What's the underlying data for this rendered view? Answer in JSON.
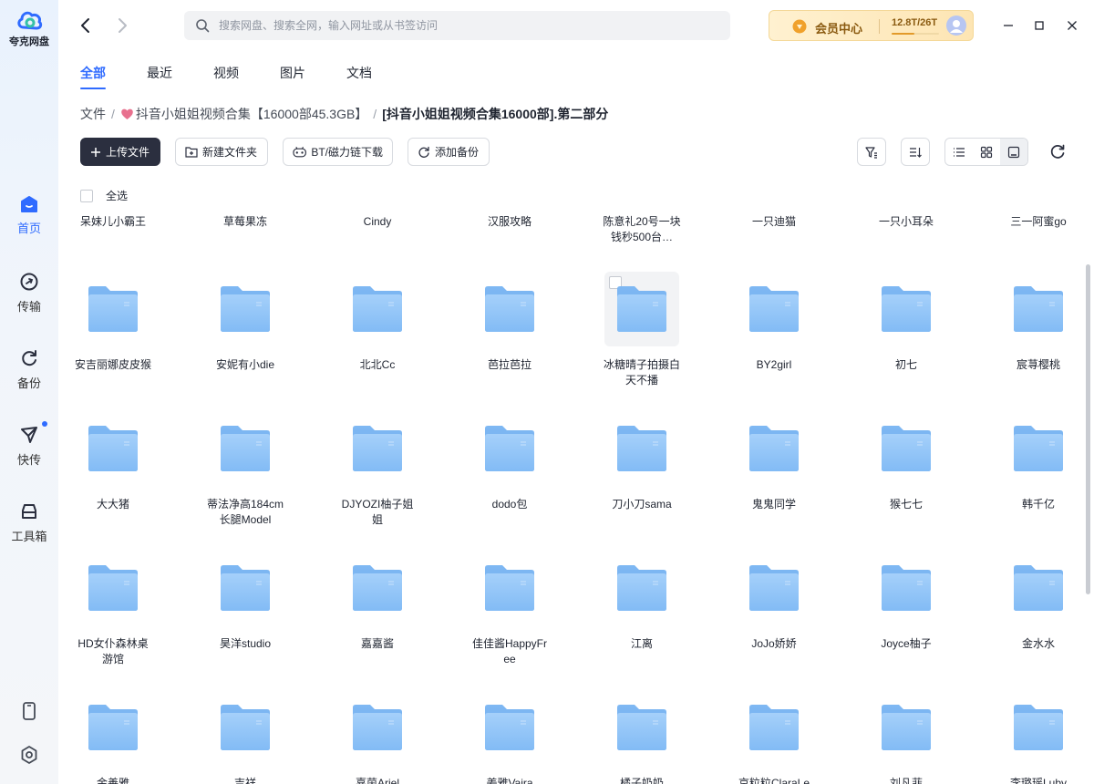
{
  "app": {
    "logo_text": "夸克网盘",
    "accent": "#2f6bff"
  },
  "sidebar": {
    "items": [
      {
        "label": "首页",
        "icon": "home-icon"
      },
      {
        "label": "传输",
        "icon": "transfer-icon"
      },
      {
        "label": "备份",
        "icon": "backup-icon"
      },
      {
        "label": "快传",
        "icon": "quick-send-icon"
      },
      {
        "label": "工具箱",
        "icon": "toolbox-icon"
      }
    ]
  },
  "search": {
    "placeholder": "搜索网盘、搜索全网，输入网址或从书签访问"
  },
  "vip": {
    "label": "会员中心",
    "storage": "12.8T/26T",
    "usage_fraction": 0.49
  },
  "tabs": [
    "全部",
    "最近",
    "视频",
    "图片",
    "文档"
  ],
  "breadcrumb": {
    "root": "文件",
    "parent": "抖音小姐姐视频合集【16000部45.3GB】",
    "current": "[抖音小姐姐视频合集16000部].第二部分"
  },
  "toolbar": {
    "upload": "上传文件",
    "new_folder": "新建文件夹",
    "bt_download": "BT/磁力链下载",
    "add_backup": "添加备份"
  },
  "select_all": "全选",
  "top_row": [
    "呆妹儿小霸王",
    "草莓果冻",
    "Cindy",
    "汉服攻略",
    "陈意礼20号一块钱秒500台…",
    "一只迪猫",
    "一只小耳朵",
    "三一阿蜜go"
  ],
  "rows": [
    [
      "安吉丽娜皮皮猴",
      "安妮有小die",
      "北北Cc",
      "芭拉芭拉",
      "冰糖晴子拍摄白天不播",
      "BY2girl",
      "初七",
      "宸荨樱桃"
    ],
    [
      "大大猪",
      "蒂法净高184cm长腿Model",
      "DJYOZI柚子姐姐",
      "dodo包",
      "刀小刀sama",
      "鬼鬼同学",
      "猴七七",
      "韩千亿"
    ],
    [
      "HD女仆森林桌游馆",
      "昊洋studio",
      "嘉嘉酱",
      "佳佳酱HappyFree",
      "江离",
      "JoJo娇娇",
      "Joyce柚子",
      "金水水"
    ],
    [
      "金善雅",
      "吉祥",
      "嘉茵Ariel",
      "姜雅Vaira",
      "橘子奶奶",
      "京粒粒ClaraLe",
      "刘凡菲",
      "李璐瑶Luby"
    ]
  ]
}
